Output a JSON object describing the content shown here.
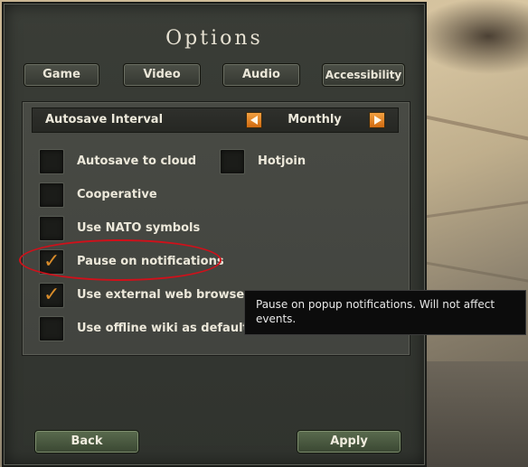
{
  "window": {
    "title": "Options"
  },
  "tabs": [
    {
      "label": "Game"
    },
    {
      "label": "Video"
    },
    {
      "label": "Audio"
    },
    {
      "label": "Accessibility"
    }
  ],
  "autosave": {
    "label": "Autosave Interval",
    "value": "Monthly"
  },
  "options": [
    {
      "label": "Autosave to cloud",
      "checked": false
    },
    {
      "label": "Hotjoin",
      "checked": false
    },
    {
      "label": "Cooperative",
      "checked": false
    },
    {
      "label": "Use NATO symbols",
      "checked": false
    },
    {
      "label": "Pause on notifications",
      "checked": true
    },
    {
      "label": "Use external web browser",
      "checked": true
    },
    {
      "label": "Use offline wiki as default",
      "checked": false
    }
  ],
  "check_glyph": "✓",
  "tooltip": {
    "text": "Pause on popup notifications. Will not affect events."
  },
  "footer": {
    "back_label": "Back",
    "apply_label": "Apply"
  },
  "colors": {
    "accent": "#d98c2a",
    "highlight": "#d0101a",
    "arrow": "#e88a2a"
  }
}
